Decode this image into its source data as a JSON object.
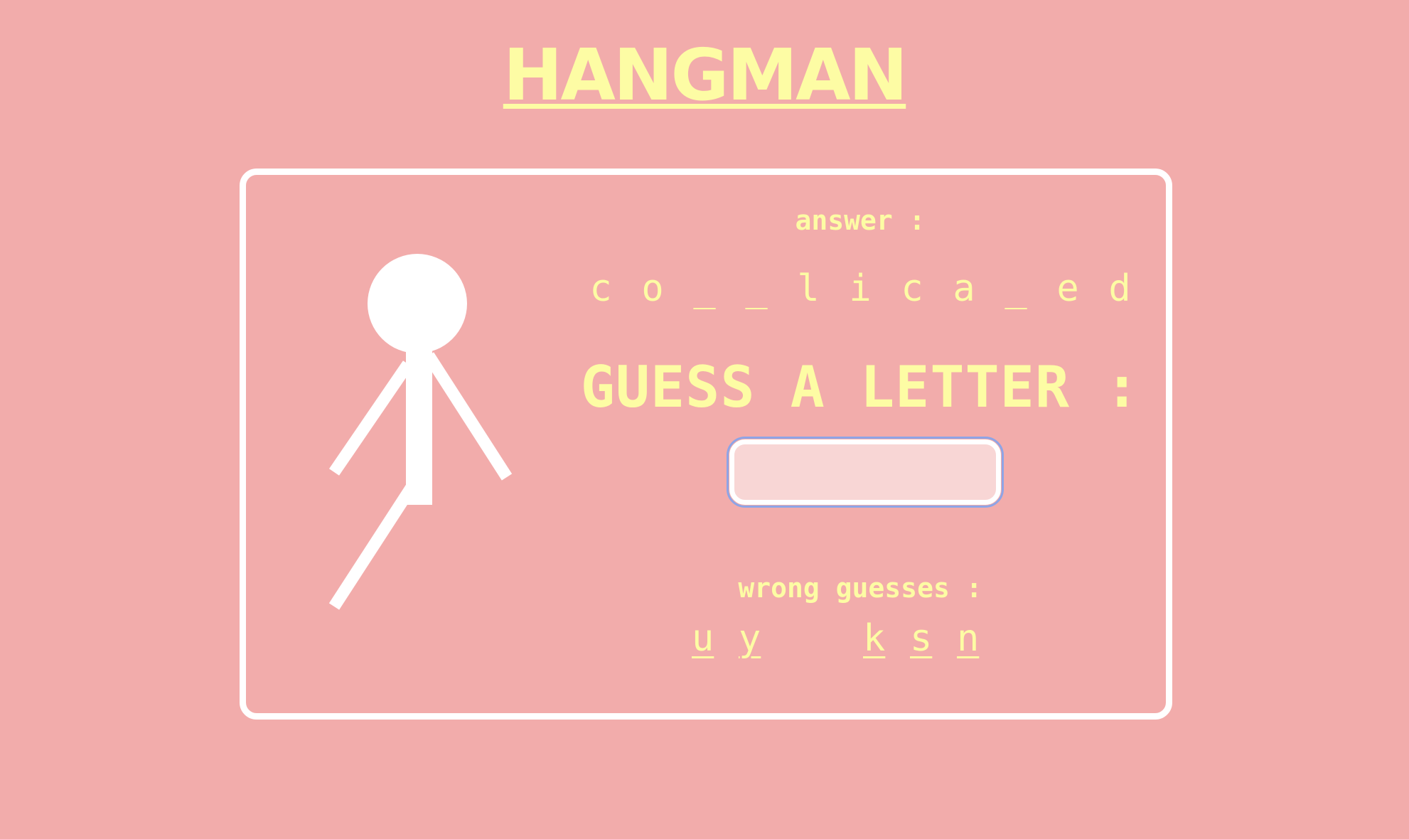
{
  "title": "HANGMAN",
  "answer": {
    "label": "answer :",
    "slots": [
      "c",
      "o",
      "_",
      "_",
      "l",
      "i",
      "c",
      "a",
      "_",
      "e",
      "d"
    ]
  },
  "guess": {
    "label": "GUESS A LETTER :",
    "value": ""
  },
  "wrong_guesses": {
    "label": "wrong guesses :",
    "letters": [
      "u",
      "y",
      "k",
      "s",
      "n"
    ]
  },
  "hangman_figure": {
    "parts_drawn": [
      "head",
      "body",
      "left-arm",
      "right-arm",
      "left-leg"
    ]
  },
  "colors": {
    "background": "#f2acab",
    "text": "#fdfca4",
    "stroke": "#ffffff",
    "input_fill": "#f8d6d5",
    "focus_ring": "#8ea4e6"
  }
}
